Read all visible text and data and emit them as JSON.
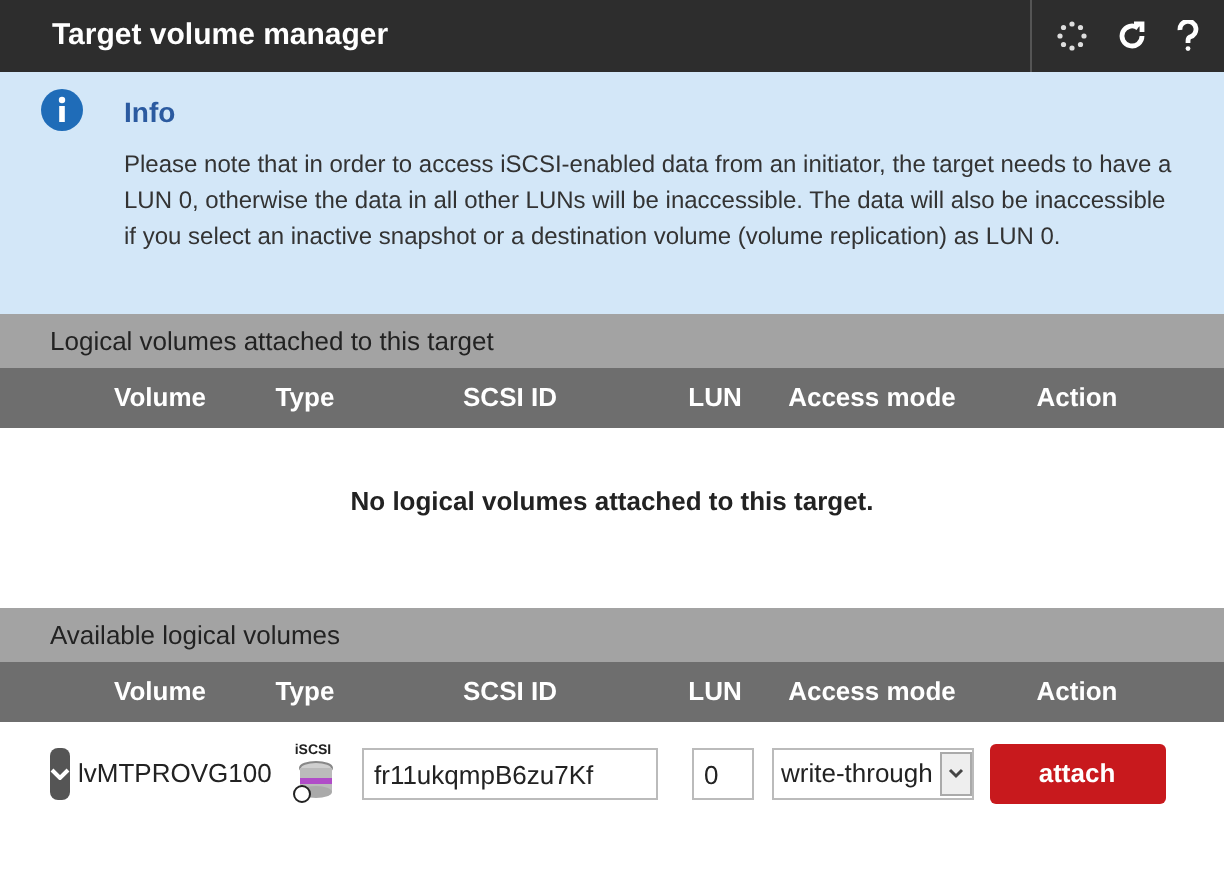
{
  "window": {
    "title": "Target volume manager"
  },
  "info": {
    "title": "Info",
    "text": "Please note that in order to access iSCSI-enabled data from an initiator, the target needs to have a LUN 0, otherwise the data in all other LUNs will be inaccessible. The data will also be inaccessible if you select an inactive snapshot or a destination volume (volume replication) as LUN 0."
  },
  "attached": {
    "title": "Logical volumes attached to this target",
    "columns": [
      "Volume",
      "Type",
      "SCSI ID",
      "LUN",
      "Access mode",
      "Action"
    ],
    "empty_message": "No logical volumes attached to this target."
  },
  "available": {
    "title": "Available logical volumes",
    "columns": [
      "Volume",
      "Type",
      "SCSI ID",
      "LUN",
      "Access mode",
      "Action"
    ],
    "rows": [
      {
        "volume": "lvMTPROVG100",
        "type_label": "iSCSI",
        "scsi_id": "fr11ukqmpB6zu7Kf",
        "lun": "0",
        "access_mode": "write-through",
        "action": "attach"
      }
    ]
  }
}
